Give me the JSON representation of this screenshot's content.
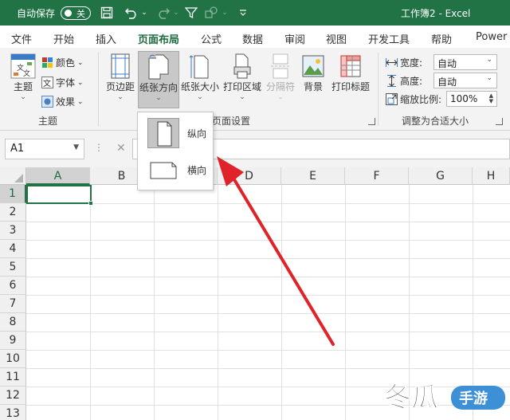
{
  "titlebar": {
    "autosave_label": "自动保存",
    "autosave_state": "关",
    "title": "工作簿2  -  Excel",
    "accent": "#217346"
  },
  "tabs": [
    "文件",
    "开始",
    "插入",
    "页面布局",
    "公式",
    "数据",
    "审阅",
    "视图",
    "开发工具",
    "帮助",
    "Power"
  ],
  "active_tab": "页面布局",
  "ribbon": {
    "theme": {
      "theme_label": "主题",
      "colors_label": "颜色",
      "fonts_label": "字体",
      "effects_label": "效果",
      "group_label": "主题"
    },
    "page_setup": {
      "margins_label": "页边距",
      "orientation_label": "纸张方向",
      "size_label": "纸张大小",
      "print_area_label": "打印区域",
      "breaks_label": "分隔符",
      "background_label": "背景",
      "print_titles_label": "打印标题",
      "group_label": "页面设置"
    },
    "scale": {
      "width_label": "宽度:",
      "width_value": "自动",
      "height_label": "高度:",
      "height_value": "自动",
      "scale_label": "缩放比例:",
      "scale_value": "100%",
      "group_label": "调整为合适大小"
    }
  },
  "formula_bar": {
    "name_box": "A1",
    "cancel_glyph": "✕"
  },
  "orientation_menu": {
    "items": [
      {
        "label": "纵向",
        "selected": true
      },
      {
        "label": "横向",
        "selected": false
      }
    ]
  },
  "grid": {
    "columns": [
      "A",
      "B",
      "C",
      "D",
      "E",
      "F",
      "G",
      "H"
    ],
    "rows": [
      "1",
      "2",
      "3",
      "4",
      "5",
      "6",
      "7",
      "8",
      "9",
      "10",
      "11",
      "12",
      "13"
    ],
    "selected_cell": "A1"
  },
  "annotation": {
    "arrow_color": "#e0232b"
  },
  "watermark": {
    "text_main": "冬瓜",
    "text_sub": "手游"
  }
}
